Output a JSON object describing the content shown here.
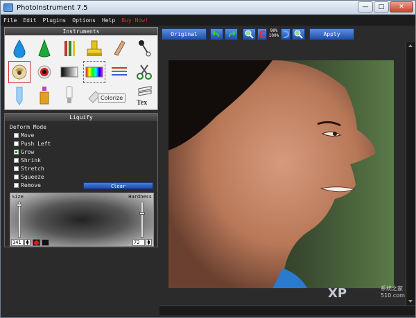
{
  "window": {
    "title": "PhotoInstrument 7.5",
    "controls": {
      "minimize": "—",
      "maximize": "□",
      "close": "✕"
    }
  },
  "menu": {
    "items": [
      "File",
      "Edit",
      "Plugins",
      "Options",
      "Help"
    ],
    "buy": "Buy Now!"
  },
  "instruments": {
    "header": "Instruments",
    "tools": [
      {
        "icon": "droplet-icon",
        "color": "#1a8fe0"
      },
      {
        "icon": "cone-icon",
        "color": "#1ca83a"
      },
      {
        "icon": "brushes-icon",
        "color": "#c03a2a"
      },
      {
        "icon": "stamp-icon",
        "color": "#e8c020"
      },
      {
        "icon": "finger-icon",
        "color": "#d9a880"
      },
      {
        "icon": "pin-icon",
        "color": "#444444"
      },
      {
        "icon": "liquify-icon",
        "color": "#c0a060"
      },
      {
        "icon": "red-eye-icon",
        "color": "#d02020"
      },
      {
        "icon": "gradient-icon",
        "color": "#777777"
      },
      {
        "icon": "colorize-icon",
        "color": "#ff0000"
      },
      {
        "icon": "lines-icon",
        "color": "#3a9a3a"
      },
      {
        "icon": "scissors-icon",
        "color": "#2a7a2a"
      },
      {
        "icon": "tube-icon",
        "color": "#5aaae0"
      },
      {
        "icon": "bottle-icon",
        "color": "#e0a020"
      },
      {
        "icon": "lamp-icon",
        "color": "#aaaaaa"
      },
      {
        "icon": "eraser-icon",
        "color": "#bbbbbb"
      },
      {
        "icon": "text-icon",
        "color": "#333333"
      }
    ],
    "tooltip": "Colorize"
  },
  "liquify": {
    "header": "Liquify",
    "deform_label": "Deform Mode",
    "modes": [
      {
        "label": "Move",
        "checked": false
      },
      {
        "label": "Push Left",
        "checked": false
      },
      {
        "label": "Grow",
        "checked": true
      },
      {
        "label": "Shrink",
        "checked": false
      },
      {
        "label": "Stretch",
        "checked": false
      },
      {
        "label": "Squeeze",
        "checked": false
      },
      {
        "label": "Remove",
        "checked": false
      }
    ],
    "clear_label": "Clear",
    "size_label": "Size",
    "hardness_label": "Hardness",
    "size_value": "341",
    "hardness_value": "72"
  },
  "toolbar": {
    "original_label": "Original",
    "apply_label": "Apply",
    "zoom_top": "90%",
    "zoom_bottom": "100%"
  },
  "watermark": {
    "main": "XP",
    "sub": "系统之家",
    "site": "510.com"
  }
}
